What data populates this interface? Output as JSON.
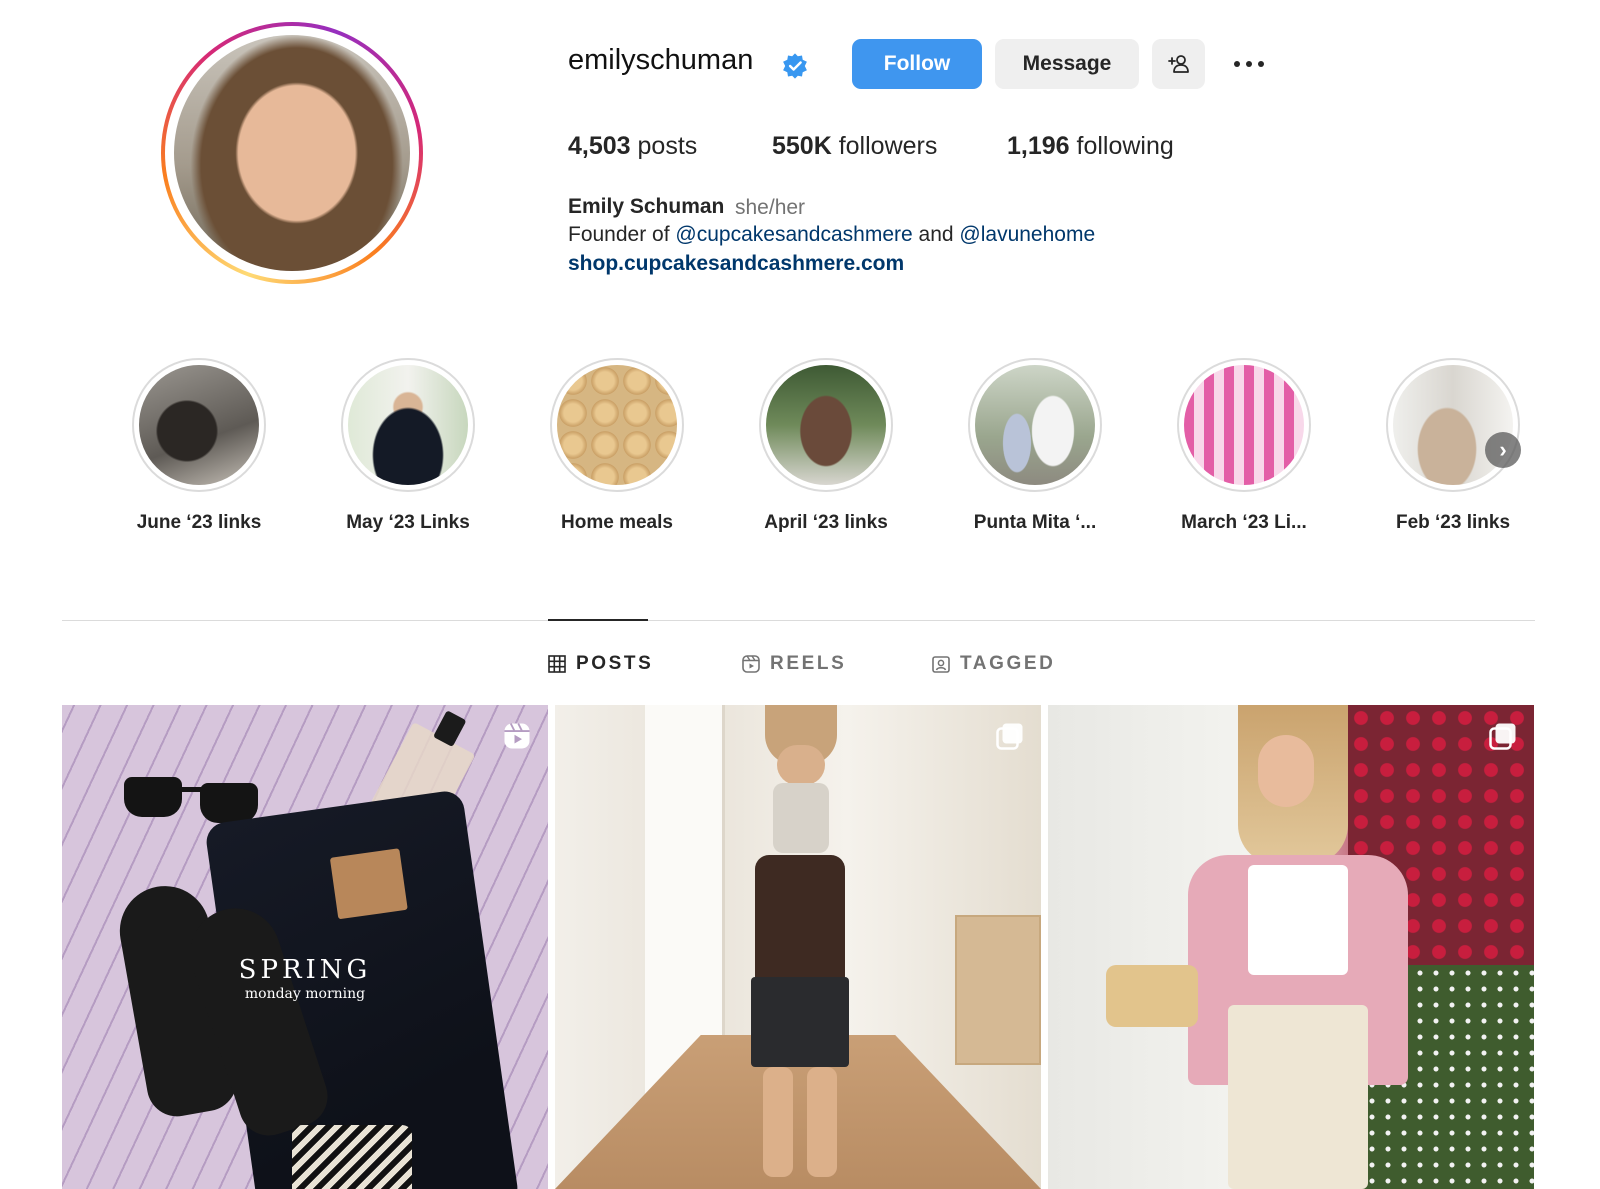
{
  "profile": {
    "username": "emilyschuman",
    "full_name": "Emily Schuman",
    "pronouns": "she/her",
    "bio_prefix": "Founder of ",
    "bio_mention_1": "@cupcakesandcashmere",
    "bio_and": " and ",
    "bio_mention_2": "@lavunehome",
    "link": "shop.cupcakesandcashmere.com",
    "verified_icon": "verified-badge-icon"
  },
  "actions": {
    "follow_label": "Follow",
    "message_label": "Message",
    "add_user_icon": "add-user-icon",
    "more_icon": "more-options-icon"
  },
  "stats": {
    "posts_count": "4,503",
    "posts_label": " posts",
    "followers_count": "550K",
    "followers_label": " followers",
    "following_count": "1,196",
    "following_label": " following"
  },
  "highlights": [
    {
      "label": "June ‘23 links"
    },
    {
      "label": "May ‘23 Links"
    },
    {
      "label": "Home meals"
    },
    {
      "label": "April ‘23 links"
    },
    {
      "label": "Punta Mita ‘..."
    },
    {
      "label": "March ‘23 Li..."
    },
    {
      "label": "Feb ‘23 links"
    }
  ],
  "tabs": [
    {
      "label": "POSTS",
      "icon": "grid-icon",
      "active": true
    },
    {
      "label": "REELS",
      "icon": "reels-icon",
      "active": false
    },
    {
      "label": "TAGGED",
      "icon": "tagged-icon",
      "active": false
    }
  ],
  "posts": [
    {
      "type": "reel",
      "overlay_title": "SPRING",
      "overlay_subtitle": "monday morning"
    },
    {
      "type": "carousel"
    },
    {
      "type": "carousel"
    }
  ],
  "colors": {
    "follow_button": "#3f96ef",
    "secondary_button": "#efefef",
    "link": "#00376b",
    "verified": "#3897f0"
  }
}
